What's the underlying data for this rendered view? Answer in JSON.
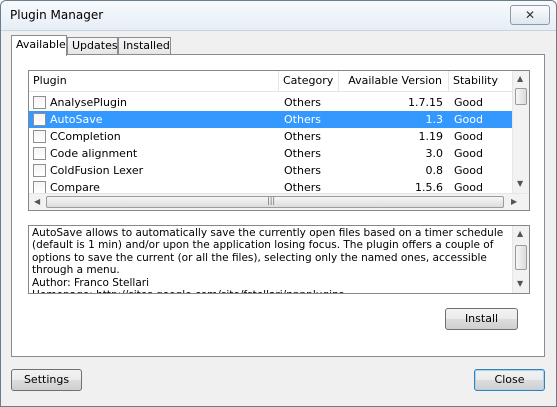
{
  "window": {
    "title": "Plugin Manager",
    "close_glyph": "✕"
  },
  "tabs": [
    {
      "label": "Available",
      "active": true
    },
    {
      "label": "Updates",
      "active": false
    },
    {
      "label": "Installed",
      "active": false
    }
  ],
  "plugin_list": {
    "columns": [
      "Plugin",
      "Category",
      "Available Version",
      "Stability"
    ],
    "rows": [
      {
        "name": "AnalysePlugin",
        "category": "Others",
        "version": "1.7.15",
        "stability": "Good",
        "checked": false,
        "selected": false
      },
      {
        "name": "AutoSave",
        "category": "Others",
        "version": "1.3",
        "stability": "Good",
        "checked": false,
        "selected": true
      },
      {
        "name": "CCompletion",
        "category": "Others",
        "version": "1.19",
        "stability": "Good",
        "checked": false,
        "selected": false
      },
      {
        "name": "Code alignment",
        "category": "Others",
        "version": "3.0",
        "stability": "Good",
        "checked": false,
        "selected": false
      },
      {
        "name": "ColdFusion Lexer",
        "category": "Others",
        "version": "0.8",
        "stability": "Good",
        "checked": false,
        "selected": false
      },
      {
        "name": "Compare",
        "category": "Others",
        "version": "1.5.6",
        "stability": "Good",
        "checked": false,
        "selected": false
      }
    ]
  },
  "description": {
    "text": "AutoSave allows to automatically save the currently open files based on a timer schedule (default is 1 min) and/or upon the application losing focus. The plugin offers a couple of options to save the current (or all the files), selecting only the named ones, accessible through a menu.\nAuthor: Franco Stellari\nHomepage: http://sites.google.com/site/fstellari/nppplugins"
  },
  "buttons": {
    "install": "Install",
    "settings": "Settings",
    "close": "Close"
  },
  "icons": {
    "scroll_up": "▲",
    "scroll_down": "▼",
    "scroll_left": "◀",
    "scroll_right": "▶",
    "grip": "|||"
  }
}
